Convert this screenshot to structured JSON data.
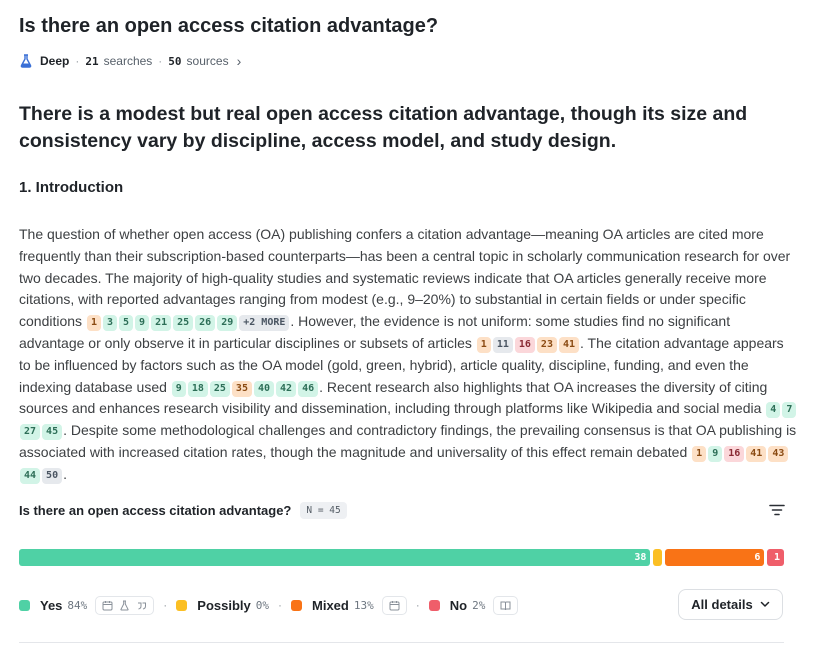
{
  "question": "Is there an open access citation advantage?",
  "meta": {
    "mode": "Deep",
    "searches_count": "21",
    "searches_label": "searches",
    "sources_count": "50",
    "sources_label": "sources"
  },
  "headline": "There is a modest but real open access citation advantage, though its size and consistency vary by discipline, access model, and study design.",
  "section": {
    "heading": "1. Introduction"
  },
  "intro": {
    "t1": "The question of whether open access (OA) publishing confers a citation advantage—meaning OA articles are cited more frequently than their subscription-based counterparts—has been a central topic in scholarly communication research for over two decades. The majority of high-quality studies and systematic reviews indicate that OA articles generally receive more citations, with reported advantages ranging from modest (e.g., 9–20%) to substantial in certain fields or under specific conditions",
    "c1": [
      "1",
      "3",
      "5",
      "9",
      "21",
      "25",
      "26",
      "29"
    ],
    "more": "+2 MORE",
    "t2": ". However, the evidence is not uniform: some studies find no significant advantage or only observe it in particular disciplines or subsets of articles",
    "c2": [
      "1",
      "11",
      "16",
      "23",
      "41"
    ],
    "t3": ". The citation advantage appears to be influenced by factors such as the OA model (gold, green, hybrid), article quality, discipline, funding, and even the indexing database used",
    "c3": [
      "9",
      "18",
      "25",
      "35",
      "40",
      "42",
      "46"
    ],
    "t4": ". Recent research also highlights that OA increases the diversity of citing sources and enhances research visibility and dissemination, including through platforms like Wikipedia and social media",
    "c4": [
      "4",
      "7",
      "27",
      "45"
    ],
    "t5": ". Despite some methodological challenges and contradictory findings, the prevailing consensus is that OA publishing is associated with increased citation rates, though the magnitude and universality of this effect remain debated",
    "c5": [
      "1",
      "9",
      "16",
      "41",
      "43",
      "44",
      "50"
    ],
    "t6": "."
  },
  "cite_colors": {
    "1": "orange",
    "3": "green",
    "5": "green",
    "9": "green",
    "21": "green",
    "25": "green",
    "26": "green",
    "29": "green",
    "11": "gray",
    "16": "red",
    "23": "orange",
    "41": "orange",
    "18": "green",
    "35": "orange",
    "40": "green",
    "42": "green",
    "46": "green",
    "4": "green",
    "7": "green",
    "27": "green",
    "45": "green",
    "43": "orange",
    "44": "green",
    "50": "gray"
  },
  "consensus": {
    "question": "Is there an open access citation advantage?",
    "n_label": "N = 45",
    "filter_icon": "filter-lines-icon",
    "results": [
      {
        "key": "yes",
        "label": "Yes",
        "pct": "84%",
        "count": 38,
        "count_label": "38",
        "color": "#4fd1a5",
        "icons": [
          "calendar-icon",
          "flask-icon",
          "quote-icon"
        ]
      },
      {
        "key": "possibly",
        "label": "Possibly",
        "pct": "0%",
        "count": 0.5,
        "count_label": "",
        "color": "#fbbf24",
        "icons": []
      },
      {
        "key": "mixed",
        "label": "Mixed",
        "pct": "13%",
        "count": 6,
        "count_label": "6",
        "color": "#f97316",
        "icons": [
          "calendar-icon"
        ]
      },
      {
        "key": "no",
        "label": "No",
        "pct": "2%",
        "count": 1,
        "count_label": "1",
        "color": "#ef5e6a",
        "icons": [
          "book-icon"
        ]
      }
    ],
    "details_button": "All details"
  }
}
